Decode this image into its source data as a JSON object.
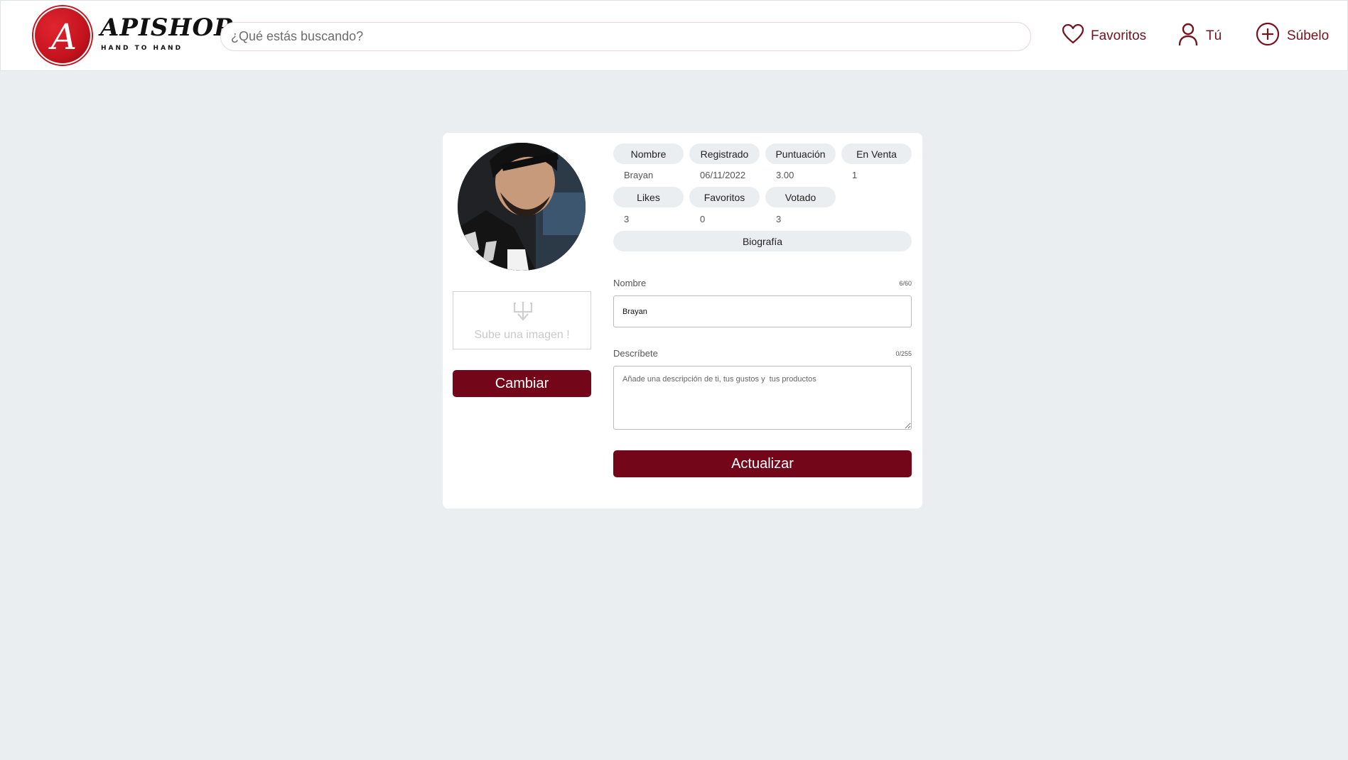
{
  "header": {
    "logo_word": "APISHOP",
    "logo_tagline": "HAND TO HAND",
    "logo_letter": "A",
    "search_placeholder": "¿Qué estás buscando?",
    "nav": {
      "favoritos": "Favoritos",
      "tu": "Tú",
      "subelo": "Súbelo"
    }
  },
  "colors": {
    "brand": "#74061a",
    "page_bg": "#ebeef1",
    "pill_bg": "#ebeef1"
  },
  "profile": {
    "stats_headers": [
      "Nombre",
      "Registrado",
      "Puntuación",
      "En Venta"
    ],
    "stats_values": [
      "Brayan",
      "06/11/2022",
      "3.00",
      "1"
    ],
    "stats2_headers": [
      "Likes",
      "Favoritos",
      "Votado"
    ],
    "stats2_values": [
      "3",
      "0",
      "3"
    ],
    "biografia_label": "Biografía"
  },
  "upload": {
    "text": "Sube una imagen !",
    "icon": "download-tray-icon"
  },
  "buttons": {
    "cambiar": "Cambiar",
    "actualizar": "Actualizar"
  },
  "form": {
    "name_label": "Nombre",
    "name_counter": "6/60",
    "name_value": "Brayan",
    "desc_label": "Descríbete",
    "desc_counter": "0/255",
    "desc_placeholder": "Añade una descripción de ti, tus gustos y  tus productos"
  }
}
